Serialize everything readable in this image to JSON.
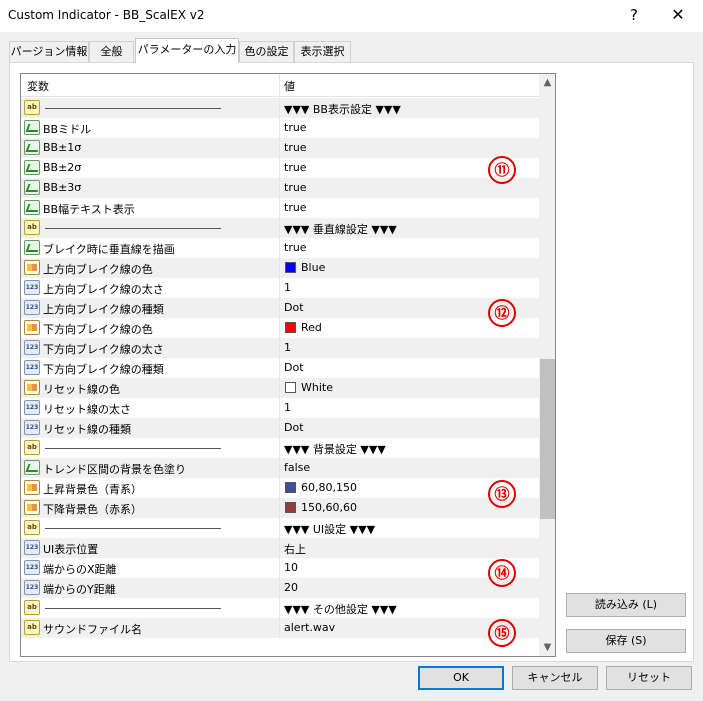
{
  "window": {
    "title": "Custom Indicator - BB_ScalEX v2",
    "help": "?",
    "close": "✕"
  },
  "tabs": [
    "パージョン情報",
    "全般",
    "パラメーターの入力",
    "色の設定",
    "表示選択"
  ],
  "grid": {
    "headers": {
      "name": "変数",
      "value": "値"
    },
    "rows": [
      {
        "type": "ab",
        "separator": true,
        "value": "▼▼▼ BB表示設定 ▼▼▼"
      },
      {
        "type": "bool",
        "name": "BBミドル",
        "value": "true"
      },
      {
        "type": "bool",
        "name": "BB±1σ",
        "value": "true"
      },
      {
        "type": "bool",
        "name": "BB±2σ",
        "value": "true"
      },
      {
        "type": "bool",
        "name": "BB±3σ",
        "value": "true"
      },
      {
        "type": "bool",
        "name": "BB幅テキスト表示",
        "value": "true"
      },
      {
        "type": "ab",
        "separator": true,
        "value": "▼▼▼ 垂直線設定 ▼▼▼"
      },
      {
        "type": "bool",
        "name": "ブレイク時に垂直線を描画",
        "value": "true"
      },
      {
        "type": "color",
        "name": "上方向ブレイク線の色",
        "value": "Blue",
        "swatch": "#0000ff"
      },
      {
        "type": "num",
        "name": "上方向ブレイク線の太さ",
        "value": "1"
      },
      {
        "type": "num",
        "name": "上方向ブレイク線の種類",
        "value": "Dot"
      },
      {
        "type": "color",
        "name": "下方向ブレイク線の色",
        "value": "Red",
        "swatch": "#ff0000"
      },
      {
        "type": "num",
        "name": "下方向ブレイク線の太さ",
        "value": "1"
      },
      {
        "type": "num",
        "name": "下方向ブレイク線の種類",
        "value": "Dot"
      },
      {
        "type": "color",
        "name": "リセット線の色",
        "value": "White",
        "swatch": "#ffffff"
      },
      {
        "type": "num",
        "name": "リセット線の太さ",
        "value": "1"
      },
      {
        "type": "num",
        "name": "リセット線の種類",
        "value": "Dot"
      },
      {
        "type": "ab",
        "separator": true,
        "value": "▼▼▼ 背景設定 ▼▼▼"
      },
      {
        "type": "bool",
        "name": "トレンド区間の背景を色塗り",
        "value": "false"
      },
      {
        "type": "color",
        "name": "上昇背景色（青系）",
        "value": "60,80,150",
        "swatch": "#3c5096"
      },
      {
        "type": "color",
        "name": "下降背景色（赤系）",
        "value": "150,60,60",
        "swatch": "#963c3c"
      },
      {
        "type": "ab",
        "separator": true,
        "value": "▼▼▼ UI設定 ▼▼▼"
      },
      {
        "type": "num",
        "name": "UI表示位置",
        "value": "右上"
      },
      {
        "type": "num",
        "name": "端からのX距離",
        "value": "10"
      },
      {
        "type": "num",
        "name": "端からのY距離",
        "value": "20"
      },
      {
        "type": "ab",
        "separator": true,
        "value": "▼▼▼ その他設定 ▼▼▼"
      },
      {
        "type": "ab",
        "name": "サウンドファイル名",
        "value": "alert.wav"
      }
    ]
  },
  "icons": {
    "ab": "ab",
    "num": "123"
  },
  "markers": [
    "⑪",
    "⑫",
    "⑬",
    "⑭",
    "⑮"
  ],
  "side_buttons": {
    "load": "読み込み (L)",
    "save": "保存 (S)"
  },
  "footer_buttons": {
    "ok": "OK",
    "cancel": "キャンセル",
    "reset": "リセット"
  },
  "scroll": {
    "up": "▲",
    "down": "▼",
    "position": 0.69
  }
}
